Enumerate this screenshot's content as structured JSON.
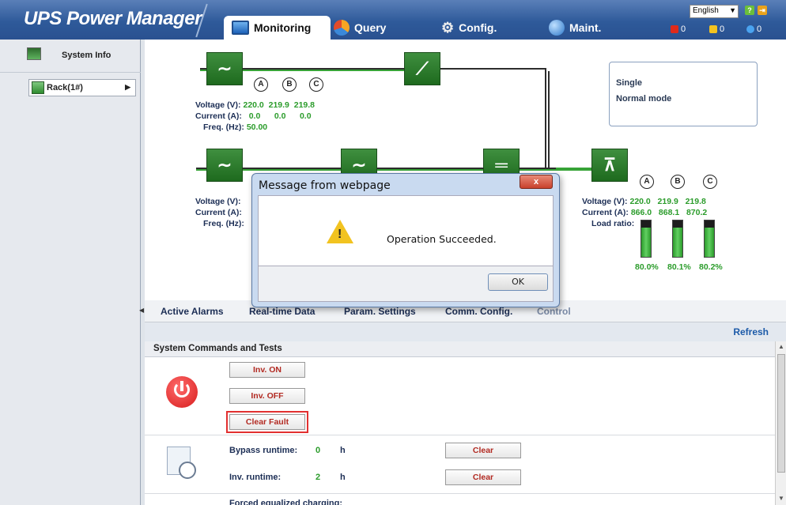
{
  "app": {
    "title": "UPS Power Manager"
  },
  "header": {
    "tabs": [
      {
        "label": "Monitoring",
        "icon": "monitor-icon",
        "active": true
      },
      {
        "label": "Query",
        "icon": "pie-chart-icon"
      },
      {
        "label": "Config.",
        "icon": "gear-icon"
      },
      {
        "label": "Maint.",
        "icon": "globe-icon"
      }
    ],
    "language": "English",
    "alarm_counts": {
      "critical": "0",
      "major": "0",
      "info": "0"
    }
  },
  "sidebar": {
    "system_info": "System Info",
    "rack": "Rack(1#)"
  },
  "diagram": {
    "phases": [
      "A",
      "B",
      "C"
    ],
    "bypass": {
      "voltage_label": "Voltage (V):",
      "voltage": [
        "220.0",
        "219.9",
        "219.8"
      ],
      "current_label": "Current (A):",
      "current": [
        "0.0",
        "0.0",
        "0.0"
      ],
      "freq_label": "Freq. (Hz):",
      "freq": "50.00"
    },
    "main": {
      "voltage_label": "Voltage (V):",
      "current_label": "Current (A):",
      "freq_label": "Freq. (Hz):"
    },
    "status": {
      "line1": "Single",
      "line2": "Normal mode"
    },
    "output": {
      "voltage_label": "Voltage (V):",
      "voltage": [
        "220.0",
        "219.9",
        "219.8"
      ],
      "current_label": "Current (A):",
      "current": [
        "866.0",
        "868.1",
        "870.2"
      ],
      "load_label": "Load ratio:",
      "load_ratio": [
        "80.0%",
        "80.1%",
        "80.2%"
      ],
      "load_values": [
        80.0,
        80.1,
        80.2
      ]
    }
  },
  "subtabs": [
    "Active Alarms",
    "Real-time Data",
    "Param. Settings",
    "Comm. Config.",
    "Control"
  ],
  "refresh": "Refresh",
  "control": {
    "section_title": "System Commands and Tests",
    "inv_on": "Inv. ON",
    "inv_off": "Inv. OFF",
    "clear_fault": "Clear Fault",
    "bypass_runtime_label": "Bypass runtime:",
    "bypass_runtime": "0",
    "inv_runtime_label": "Inv. runtime:",
    "inv_runtime": "2",
    "unit": "h",
    "clear": "Clear",
    "forced_label": "Forced equalized charging:"
  },
  "dialog": {
    "title": "Message from webpage",
    "message": "Operation Succeeded.",
    "ok": "OK",
    "close": "x"
  },
  "colors": {
    "header": "#2e5a9a",
    "module_green": "#2b8a2b",
    "value_green": "#2b9c2b",
    "button_red": "#b22a22",
    "highlight": "#e23030"
  }
}
